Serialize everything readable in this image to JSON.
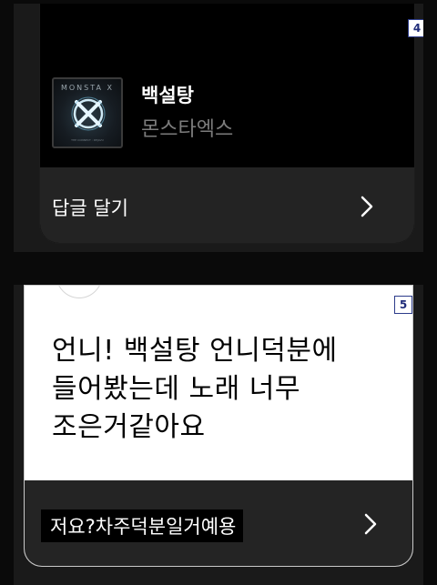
{
  "panel1": {
    "badge": "4",
    "album": {
      "brand_text": "MONSTA X",
      "fine_print": "THE CONNECT : DEJAVU"
    },
    "song_title": "백설탕",
    "artist": "몬스타엑스",
    "reply_label": "답글 달기",
    "chevron_icon": "chevron-right-icon"
  },
  "panel2": {
    "badge": "5",
    "message_lines": [
      "언니! 백설탕 언니덕분에",
      "들어봤는데 노래 너무",
      "조은거같아요"
    ],
    "answer": "저요?차주덕분일거예용",
    "chevron_icon": "chevron-right-icon"
  },
  "colors": {
    "background": "#0a0a0a",
    "card_dark": "#000000",
    "footer_dark": "#232323",
    "artist_gray": "#7c7c7c",
    "badge_blue": "#1f2c7a"
  }
}
